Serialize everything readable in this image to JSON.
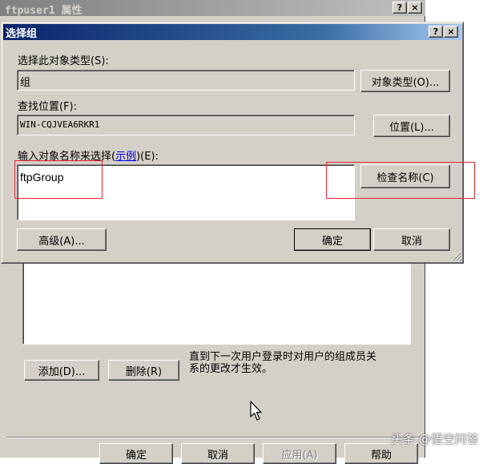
{
  "bg_window": {
    "title": "ftpuser1 属性",
    "help_btn": "?",
    "close_btn": "×",
    "note": "直到下一次用户登录时对用户的组成员关系的更改才生效。",
    "add_button": "添加(D)...",
    "remove_button": "删除(R)",
    "ok_button": "确定",
    "cancel_button": "取消",
    "apply_button": "应用(A)",
    "help_button": "帮助"
  },
  "dialog": {
    "title": "选择组",
    "help_btn": "?",
    "close_btn": "×",
    "object_type_label": "选择此对象类型(S):",
    "object_type_value": "组",
    "object_types_button": "对象类型(O)...",
    "location_label": "查找位置(F):",
    "location_value": "WIN-CQJVEA6RKR1",
    "location_button": "位置(L)...",
    "names_label_prefix": "输入对象名称来选择(",
    "names_label_link": "示例",
    "names_label_suffix": ")(E):",
    "names_value": "ftpGroup",
    "check_names_button": "检查名称(C)",
    "advanced_button": "高级(A)...",
    "ok_button": "确定",
    "cancel_button": "取消"
  },
  "watermark": {
    "text": "头条 @悟空问答"
  },
  "colors": {
    "title_bar_active": "#0a246a",
    "title_bar_inactive": "#808080",
    "face": "#d4d0c8",
    "highlight_box": "#e8242a",
    "link": "#0000ee"
  }
}
